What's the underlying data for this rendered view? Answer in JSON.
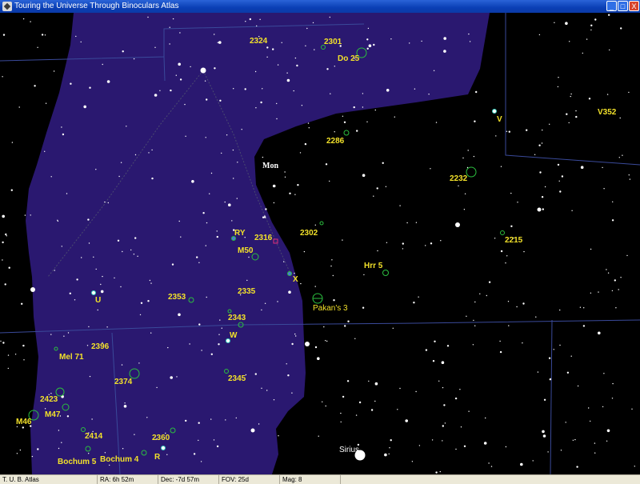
{
  "window": {
    "title": "Touring the Universe Through Binoculars Atlas",
    "buttons": {
      "minimize": "_",
      "maximize": "□",
      "close": "X"
    }
  },
  "colors": {
    "background": "#000000",
    "milky_way": "#2a1870",
    "label": "#f2e12a",
    "constellation_line": "#3a4a9a",
    "cluster_ring": "#2bbf3f",
    "star": "#ffffff"
  },
  "constellation": {
    "name": "Mon"
  },
  "objects": [
    {
      "label": "2324",
      "kind": "cluster"
    },
    {
      "label": "2301",
      "kind": "cluster"
    },
    {
      "label": "Do 25",
      "kind": "cluster"
    },
    {
      "label": "V",
      "kind": "variable"
    },
    {
      "label": "V352",
      "kind": "variable"
    },
    {
      "label": "2286",
      "kind": "cluster"
    },
    {
      "label": "2232",
      "kind": "cluster"
    },
    {
      "label": "RY",
      "kind": "variable"
    },
    {
      "label": "2316",
      "kind": "nebula"
    },
    {
      "label": "2302",
      "kind": "cluster"
    },
    {
      "label": "2215",
      "kind": "cluster"
    },
    {
      "label": "M50",
      "kind": "cluster"
    },
    {
      "label": "Hrr 5",
      "kind": "cluster"
    },
    {
      "label": "X",
      "kind": "variable"
    },
    {
      "label": "U",
      "kind": "variable"
    },
    {
      "label": "2353",
      "kind": "cluster"
    },
    {
      "label": "2335",
      "kind": "cluster"
    },
    {
      "label": "Pakan's 3",
      "kind": "asterism"
    },
    {
      "label": "2343",
      "kind": "cluster"
    },
    {
      "label": "W",
      "kind": "variable"
    },
    {
      "label": "Mel 71",
      "kind": "cluster"
    },
    {
      "label": "2396",
      "kind": "cluster"
    },
    {
      "label": "2374",
      "kind": "cluster"
    },
    {
      "label": "2345",
      "kind": "cluster"
    },
    {
      "label": "2423",
      "kind": "cluster"
    },
    {
      "label": "M47",
      "kind": "cluster"
    },
    {
      "label": "M46",
      "kind": "cluster"
    },
    {
      "label": "2414",
      "kind": "cluster"
    },
    {
      "label": "2360",
      "kind": "cluster"
    },
    {
      "label": "R",
      "kind": "variable"
    },
    {
      "label": "Bochum 5",
      "kind": "cluster"
    },
    {
      "label": "Bochum 4",
      "kind": "cluster"
    },
    {
      "label": "Sirius",
      "kind": "star"
    }
  ],
  "status": {
    "app": "T. U. B. Atlas",
    "ra": "RA: 6h 52m",
    "dec": "Dec: -7d 57m",
    "fov": "FOV: 25d",
    "mag": "Mag: 8"
  }
}
